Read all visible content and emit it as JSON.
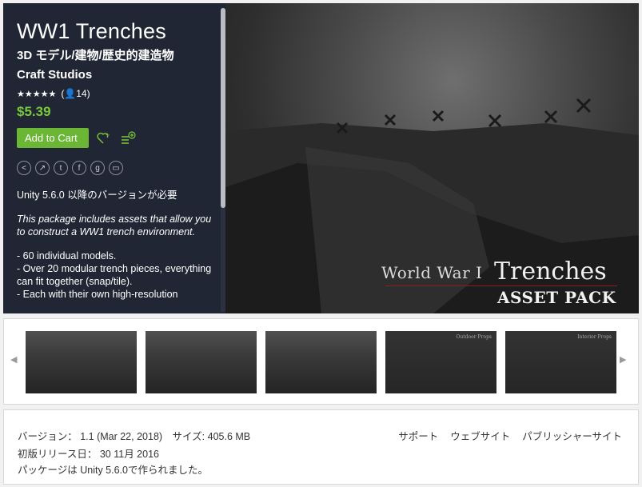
{
  "product": {
    "title": "WW1 Trenches",
    "category": "3D モデル/建物/歴史的建造物",
    "publisher": "Craft Studios",
    "stars": "★★★★★",
    "rating_count": "(👤14)",
    "price": "$5.39",
    "add_to_cart_label": "Add to Cart",
    "requires": "Unity 5.6.0 以降のバージョンが必要",
    "description": "This package includes assets that allow you to construct a WW1 trench environment.",
    "bullets": [
      "- 60 individual models.",
      "- Over 20 modular trench pieces, everything can fit together (snap/tile).",
      "- Each with their own high-resolution"
    ]
  },
  "hero": {
    "logo_world_war": "World War I",
    "logo_trenches": "Trenches",
    "logo_asset_pack": "ASSET PACK"
  },
  "thumbnails": [
    {
      "label": ""
    },
    {
      "label": ""
    },
    {
      "label": ""
    },
    {
      "label": "Outdoor Props"
    },
    {
      "label": "Interior Props"
    }
  ],
  "icons": {
    "wishlist": "heart-plus-icon",
    "add_to_list": "list-plus-icon",
    "shares": [
      "share-icon",
      "link-icon",
      "twitter-icon",
      "facebook-icon",
      "google-plus-icon",
      "embed-icon"
    ],
    "arrow_left": "◀",
    "arrow_right": "▶"
  },
  "info": {
    "version_line": "バージョン： 1.1 (Mar 22, 2018)　サイズ: 405.6 MB",
    "release_line": "初版リリース日： 30 11月 2016",
    "unity_line": "パッケージは Unity 5.6.0で作られました。",
    "links": [
      "サポート",
      "ウェブサイト",
      "パブリッシャーサイト"
    ]
  },
  "colors": {
    "panel_bg": "#202633",
    "price_green": "#7bc83b",
    "button_green": "#6bb634"
  }
}
